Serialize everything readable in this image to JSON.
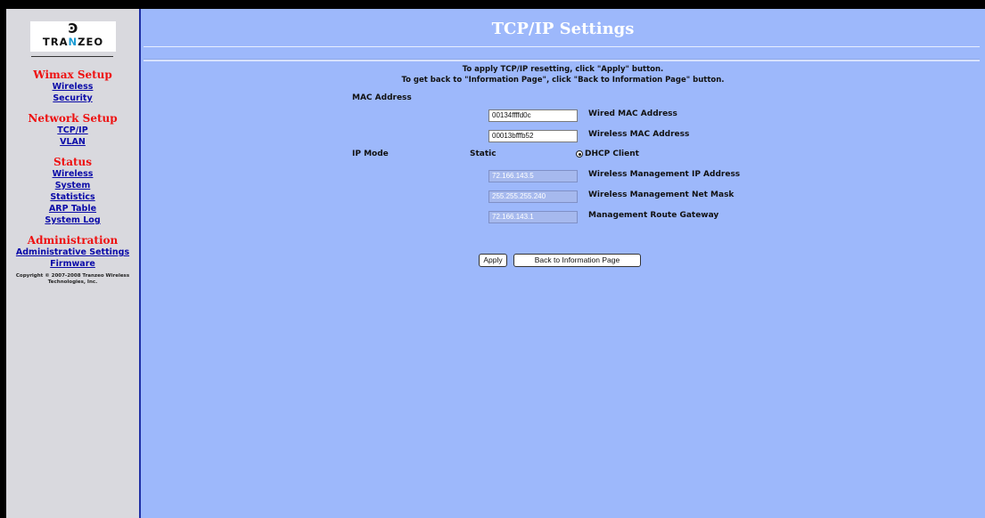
{
  "logo": {
    "mark": "Ͽ",
    "text_pre": "TRA",
    "text_n": "N",
    "text_post": "ZEO"
  },
  "sidebar": {
    "wimax_setup": {
      "heading": "Wimax Setup",
      "links": [
        "Wireless",
        "Security"
      ]
    },
    "network_setup": {
      "heading": "Network Setup",
      "links": [
        "TCP/IP",
        "VLAN"
      ]
    },
    "status": {
      "heading": "Status",
      "links": [
        "Wireless",
        "System",
        "Statistics",
        "ARP Table",
        "System Log"
      ]
    },
    "administration": {
      "heading": "Administration",
      "links": [
        "Administrative Settings",
        "Firmware"
      ]
    },
    "copyright": "Copyright © 2007-2008 Tranzeo Wireless Technologies, Inc."
  },
  "main": {
    "title": "TCP/IP Settings",
    "info_line1": "To apply TCP/IP resetting, click \"Apply\" button.",
    "info_line2": "To get back to \"Information Page\", click \"Back to Information Page\" button.",
    "mac_section_label": "MAC Address",
    "wired_mac": {
      "value": "00134ffffd0c",
      "label": "Wired MAC Address"
    },
    "wireless_mac": {
      "value": "00013bfffb52",
      "label": "Wireless MAC Address"
    },
    "ip_mode": {
      "label": "IP Mode",
      "static_label": "Static",
      "dhcp_label": "DHCP Client",
      "selected": "DHCP Client"
    },
    "mgmt_ip": {
      "value": "72.166.143.5",
      "label": "Wireless Management IP Address"
    },
    "net_mask": {
      "value": "255.255.255.240",
      "label": "Wireless Management Net Mask"
    },
    "gateway": {
      "value": "72.166.143.1",
      "label": "Management Route Gateway"
    },
    "apply_button": "Apply",
    "back_button": "Back to Information Page"
  },
  "colors": {
    "main_bg": "#9db8fb",
    "sidebar_bg": "#d9d9de",
    "heading_red": "#ee1111",
    "link_blue": "#0a0aa8"
  }
}
